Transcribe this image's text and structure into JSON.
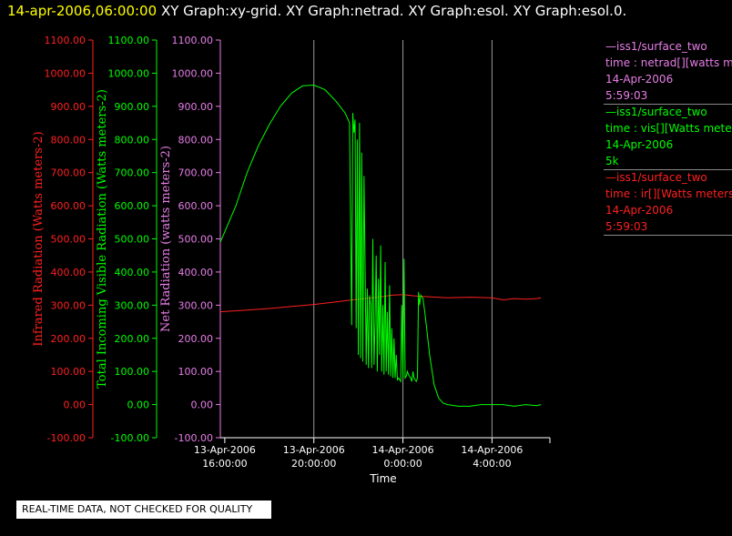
{
  "header": {
    "time": "14-apr-2006,06:00:00",
    "graphs": "XY Graph:xy-grid.  XY Graph:netrad.  XY Graph:esol.  XY Graph:esol.0."
  },
  "legend": [
    {
      "series": "—iss1/surface_two",
      "field": "time : netrad[][watts met",
      "date": "14-Apr-2006",
      "value": "5:59:03",
      "color": "#e87ee8"
    },
    {
      "series": "—iss1/surface_two",
      "field": "time : vis[][Watts meter",
      "date": "14-Apr-2006",
      "value": "5k",
      "color": "#00ff00"
    },
    {
      "series": "—iss1/surface_two",
      "field": "time : ir[][Watts meters",
      "date": "14-Apr-2006",
      "value": "5:59:03",
      "color": "#ff2020"
    }
  ],
  "quality_note": "REAL-TIME DATA, NOT CHECKED FOR QUALITY",
  "chart_data": {
    "type": "line",
    "xlabel": "Time",
    "x_ticks": [
      {
        "date": "13-Apr-2006",
        "time": "16:00:00",
        "hours": 0
      },
      {
        "date": "13-Apr-2006",
        "time": "20:00:00",
        "hours": 4
      },
      {
        "date": "14-Apr-2006",
        "time": "0:00:00",
        "hours": 8
      },
      {
        "date": "14-Apr-2006",
        "time": "4:00:00",
        "hours": 12
      }
    ],
    "xlim_hours": [
      -0.2,
      14.6
    ],
    "grid_lines_hours": [
      4,
      8,
      12
    ],
    "ylim": [
      -100,
      1100
    ],
    "y_tick_labels": [
      "-100.00",
      "0.00",
      "100.00",
      "200.00",
      "300.00",
      "400.00",
      "500.00",
      "600.00",
      "700.00",
      "800.00",
      "900.00",
      "1000.00",
      "1100.00"
    ],
    "axes": [
      {
        "label": "Infrared Radiation (Watts meters-2)",
        "color": "#ff2020"
      },
      {
        "label": "Total Incoming Visible Radiation (Watts meters-2)",
        "color": "#00ff00"
      },
      {
        "label": "Net Radiation (watts meters-2)",
        "color": "#e87ee8"
      }
    ],
    "series": [
      {
        "name": "ir",
        "color": "#ff2020",
        "x": [
          -0.2,
          1,
          2,
          3,
          4,
          5,
          6,
          7,
          7.5,
          8,
          8.5,
          9,
          10,
          11,
          12,
          12.5,
          13,
          13.5,
          14,
          14.2
        ],
        "y": [
          280,
          285,
          290,
          296,
          302,
          310,
          318,
          325,
          330,
          332,
          328,
          326,
          322,
          324,
          322,
          316,
          320,
          318,
          320,
          322
        ]
      },
      {
        "name": "vis",
        "color": "#00ff00",
        "x": [
          -0.2,
          0.5,
          1,
          1.5,
          2,
          2.5,
          3,
          3.5,
          4,
          4.5,
          5,
          5.4,
          5.6,
          5.7,
          5.75,
          5.8,
          5.85,
          5.9,
          5.95,
          6.0,
          6.05,
          6.1,
          6.15,
          6.2,
          6.25,
          6.3,
          6.35,
          6.4,
          6.45,
          6.5,
          6.55,
          6.6,
          6.65,
          6.7,
          6.75,
          6.8,
          6.85,
          6.9,
          6.95,
          7.0,
          7.05,
          7.1,
          7.15,
          7.2,
          7.25,
          7.3,
          7.35,
          7.4,
          7.45,
          7.5,
          7.55,
          7.6,
          7.65,
          7.7,
          7.75,
          7.8,
          7.85,
          7.9,
          7.95,
          8.0,
          8.05,
          8.1,
          8.15,
          8.2,
          8.25,
          8.3,
          8.35,
          8.4,
          8.45,
          8.5,
          8.55,
          8.6,
          8.65,
          8.7,
          8.75,
          8.8,
          8.9,
          9.0,
          9.2,
          9.4,
          9.6,
          9.8,
          10,
          10.5,
          11,
          11.5,
          12,
          12.5,
          13,
          13.5,
          14,
          14.2
        ],
        "y": [
          490,
          600,
          700,
          780,
          845,
          900,
          940,
          962,
          964,
          950,
          915,
          880,
          850,
          240,
          880,
          820,
          860,
          230,
          800,
          150,
          850,
          140,
          760,
          130,
          690,
          420,
          120,
          350,
          110,
          330,
          300,
          110,
          500,
          120,
          250,
          450,
          100,
          380,
          150,
          480,
          100,
          300,
          90,
          430,
          100,
          280,
          90,
          360,
          85,
          230,
          80,
          200,
          80,
          150,
          75,
          80,
          75,
          70,
          300,
          80,
          440,
          80,
          85,
          100,
          90,
          85,
          80,
          70,
          100,
          80,
          75,
          70,
          80,
          340,
          300,
          330,
          320,
          270,
          150,
          60,
          20,
          5,
          0,
          -5,
          -5,
          0,
          0,
          0,
          -5,
          0,
          -3,
          0
        ]
      }
    ]
  }
}
